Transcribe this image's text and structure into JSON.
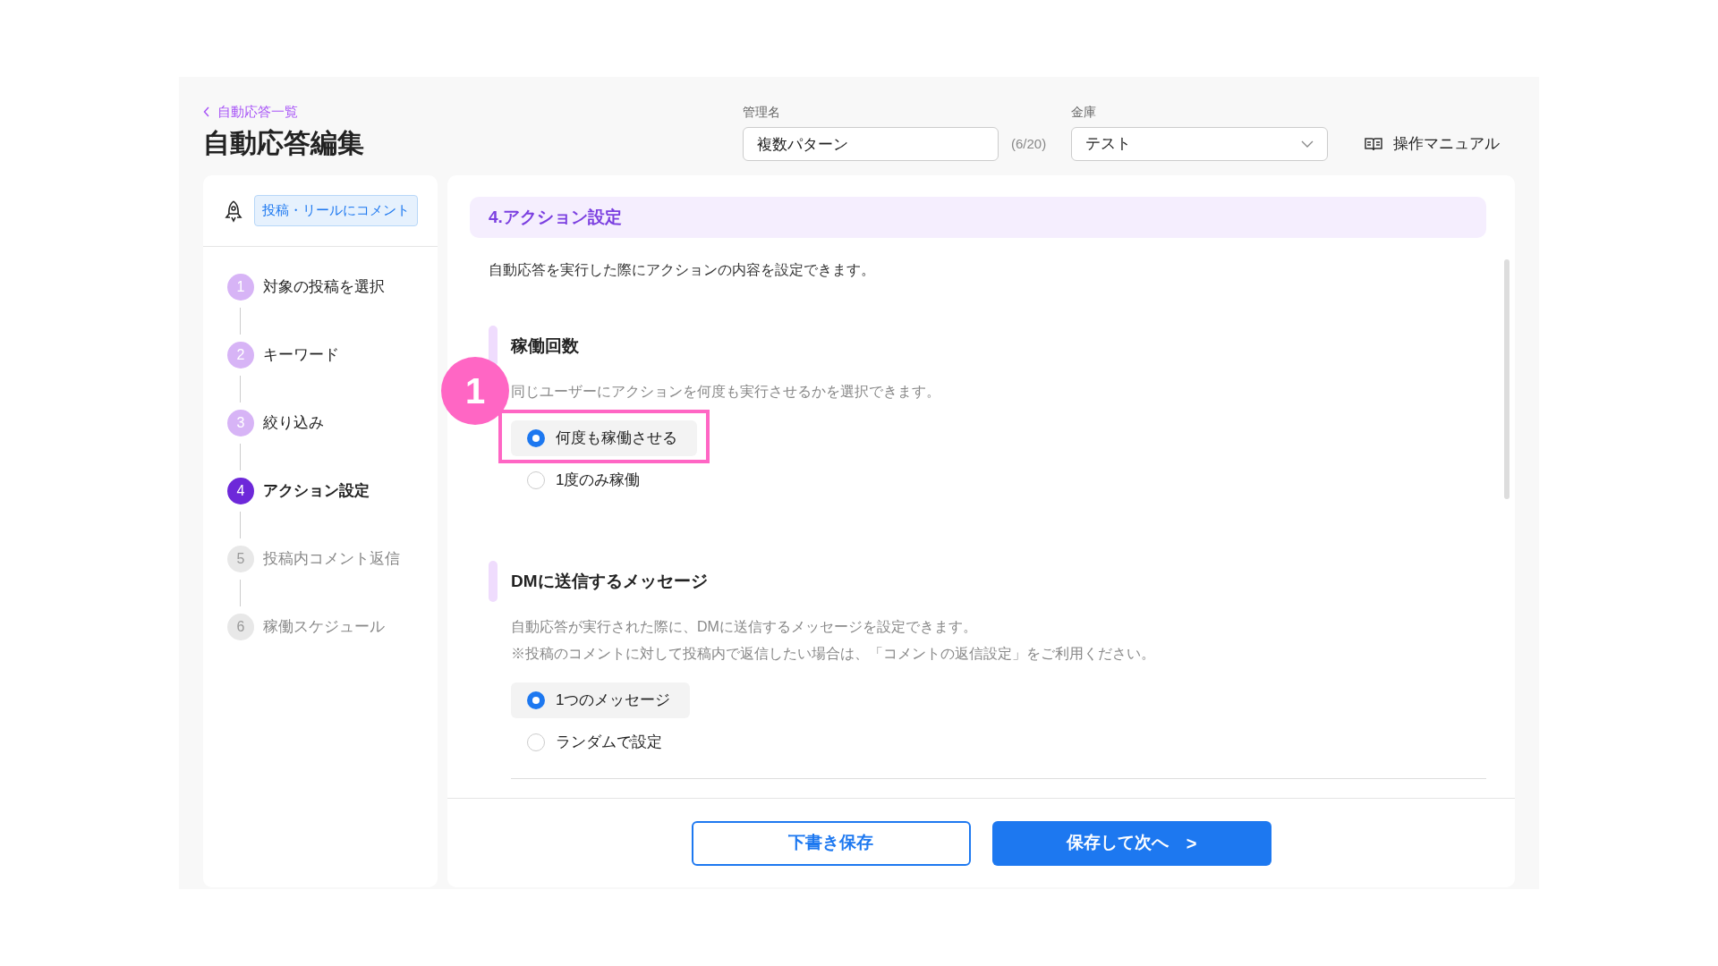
{
  "header": {
    "back_link": "自動応答一覧",
    "title": "自動応答編集",
    "name_field": {
      "label": "管理名",
      "value": "複数パターン",
      "counter": "(6/20)"
    },
    "vault_field": {
      "label": "金庫",
      "value": "テスト"
    },
    "manual_link": "操作マニュアル"
  },
  "sidebar": {
    "trigger_tag": "投稿・リールにコメント",
    "steps": [
      {
        "number": "1",
        "label": "対象の投稿を選択",
        "completed": true,
        "selected": false
      },
      {
        "number": "2",
        "label": "キーワード",
        "completed": true,
        "selected": false
      },
      {
        "number": "3",
        "label": "絞り込み",
        "completed": true,
        "selected": false
      },
      {
        "number": "4",
        "label": "アクション設定",
        "completed": false,
        "selected": true
      },
      {
        "number": "5",
        "label": "投稿内コメント返信",
        "completed": false,
        "selected": false
      },
      {
        "number": "6",
        "label": "稼働スケジュール",
        "completed": false,
        "selected": false
      }
    ]
  },
  "main": {
    "section_title": "4.アクション設定",
    "description": "自動応答を実行した際にアクションの内容を設定できます。",
    "groups": [
      {
        "title": "稼働回数",
        "hints": [
          "同じユーザーにアクションを何度も実行させるかを選択できます。"
        ],
        "options": [
          {
            "label": "何度も稼働させる",
            "selected": true,
            "callout": "1"
          },
          {
            "label": "1度のみ稼働",
            "selected": false
          }
        ]
      },
      {
        "title": "DMに送信するメッセージ",
        "hints": [
          "自動応答が実行された際に、DMに送信するメッセージを設定できます。",
          "※投稿のコメントに対して投稿内で返信したい場合は、「コメントの返信設定」をご利用ください。"
        ],
        "options": [
          {
            "label": "1つのメッセージ",
            "selected": true
          },
          {
            "label": "ランダムで設定",
            "selected": false
          }
        ]
      }
    ]
  },
  "footer": {
    "draft_button": "下書き保存",
    "next_button": "保存して次へ",
    "next_icon": ">"
  }
}
